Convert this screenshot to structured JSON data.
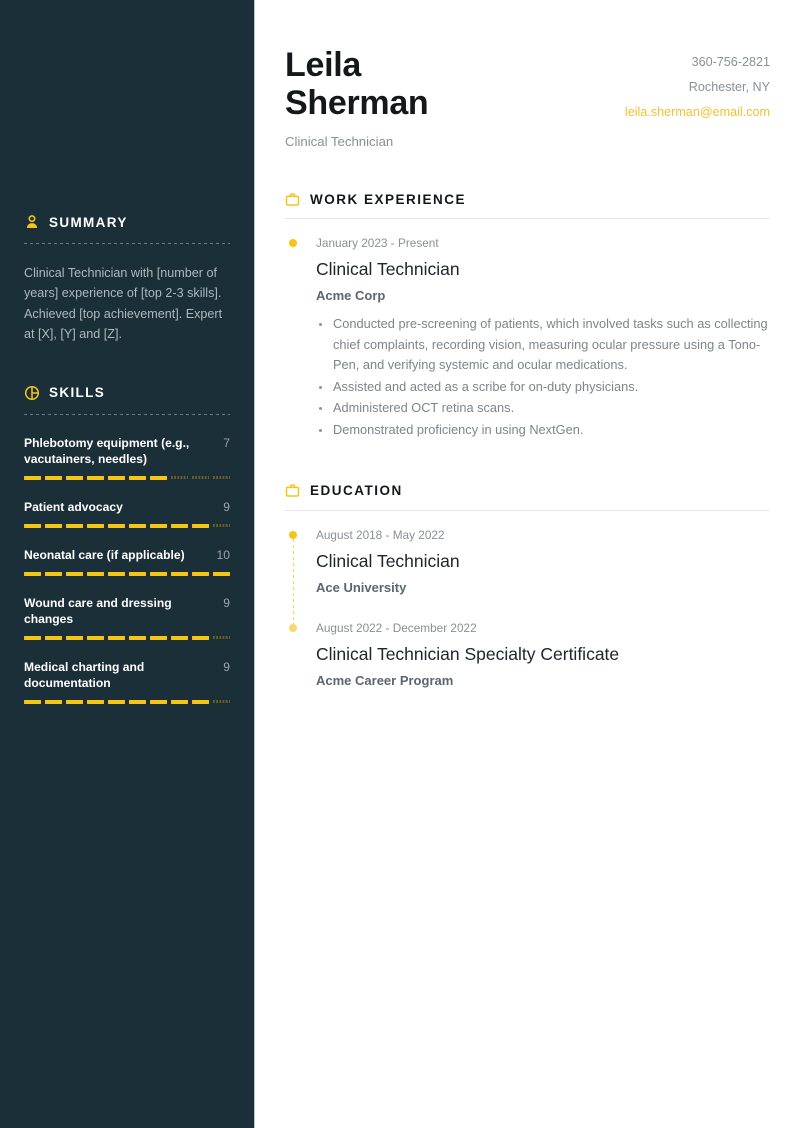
{
  "header": {
    "first_name": "Leila",
    "last_name": "Sherman",
    "role": "Clinical Technician",
    "phone": "360-756-2821",
    "location": "Rochester, NY",
    "email": "leila.sherman@email.com",
    "accent_color": "#f5c518",
    "email_color": "#f0c231"
  },
  "sidebar": {
    "background_color": "#1b2f38",
    "summary": {
      "icon": "person-icon",
      "title": "SUMMARY",
      "text": "Clinical Technician with [number of years] experience of [top 2-3 skills]. Achieved [top achievement]. Expert at [X], [Y] and [Z]."
    },
    "skills": {
      "icon": "pie-chart-icon",
      "title": "SKILLS",
      "max": 10,
      "items": [
        {
          "name": "Phlebotomy equipment (e.g., vacutainers, needles)",
          "score": 7
        },
        {
          "name": "Patient advocacy",
          "score": 9
        },
        {
          "name": "Neonatal care (if applicable)",
          "score": 10
        },
        {
          "name": "Wound care and dressing changes",
          "score": 9
        },
        {
          "name": "Medical charting and documentation",
          "score": 9
        }
      ]
    }
  },
  "main": {
    "work_experience": {
      "icon": "briefcase-icon",
      "title": "WORK EXPERIENCE",
      "entries": [
        {
          "date": "January 2023 - Present",
          "title": "Clinical Technician",
          "org": "Acme Corp",
          "bullets": [
            "Conducted pre-screening of patients, which involved tasks such as collecting chief complaints, recording vision, measuring ocular pressure using a Tono-Pen, and verifying systemic and ocular medications.",
            "Assisted and acted as a scribe for on-duty physicians.",
            "Administered OCT retina scans.",
            "Demonstrated proficiency in using NextGen."
          ]
        }
      ]
    },
    "education": {
      "icon": "briefcase-icon",
      "title": "EDUCATION",
      "entries": [
        {
          "date": "August 2018 - May 2022",
          "title": "Clinical Technician",
          "org": "Ace University",
          "bullets": []
        },
        {
          "date": "August 2022 - December 2022",
          "title": "Clinical Technician Specialty Certificate",
          "org": "Acme Career Program",
          "bullets": []
        }
      ]
    }
  }
}
